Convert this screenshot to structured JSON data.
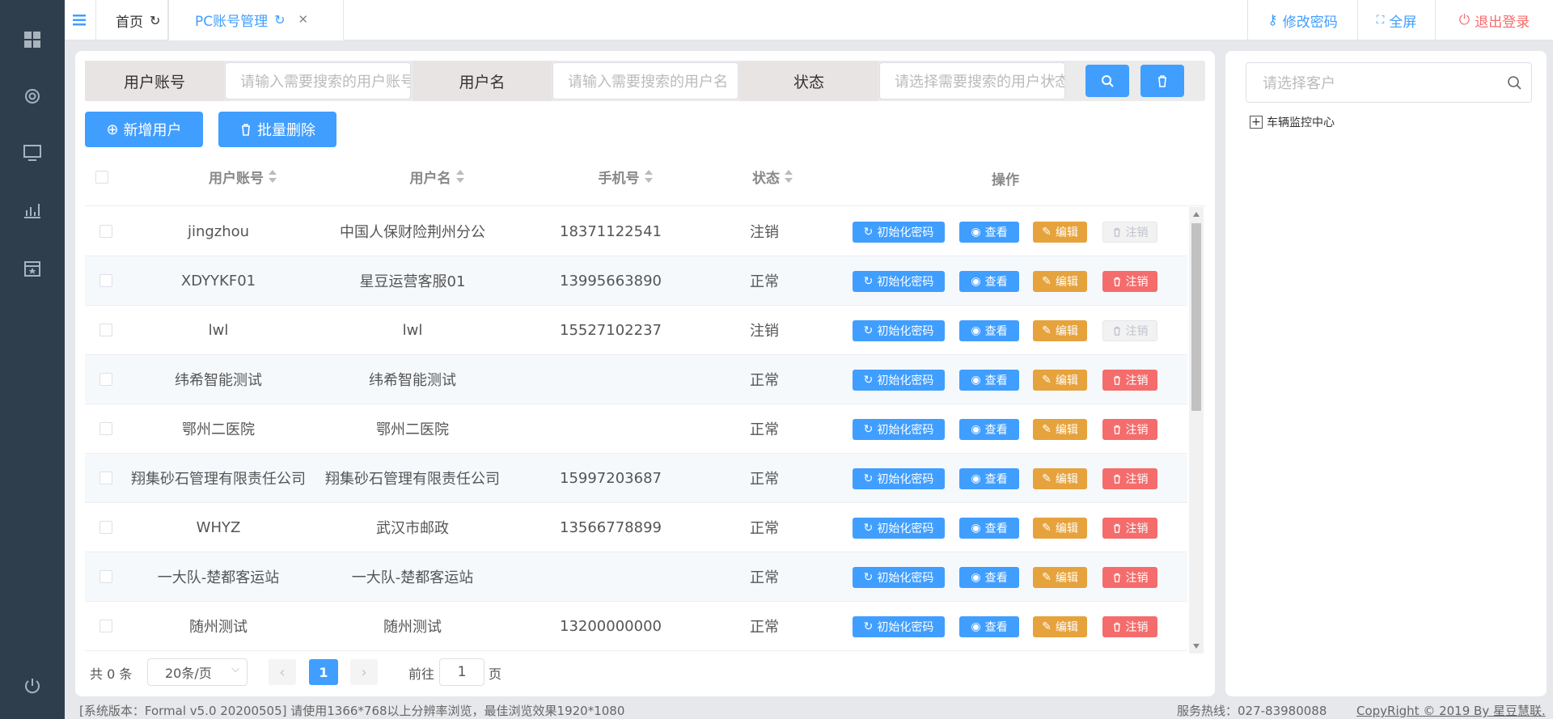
{
  "sidebar": {
    "icons": [
      "dashboard-icon",
      "gear-icon",
      "monitor-icon",
      "chart-icon",
      "calendar-icon",
      "power-icon"
    ]
  },
  "tabs": [
    {
      "label": "首页"
    },
    {
      "label": "PC账号管理"
    }
  ],
  "top_actions": {
    "change_password": "修改密码",
    "fullscreen": "全屏",
    "logout": "退出登录"
  },
  "search": {
    "account_label": "用户账号",
    "account_placeholder": "请输入需要搜索的用户账号",
    "username_label": "用户名",
    "username_placeholder": "请输入需要搜索的用户名",
    "status_label": "状态",
    "status_placeholder": "请选择需要搜索的用户状态"
  },
  "toolbar": {
    "add_label": "新增用户",
    "batch_delete_label": "批量删除"
  },
  "table": {
    "headers": {
      "account": "用户账号",
      "username": "用户名",
      "phone": "手机号",
      "status": "状态",
      "actions": "操作"
    },
    "action_labels": {
      "reset": "初始化密码",
      "view": "查看",
      "edit": "编辑",
      "cancel": "注销"
    },
    "rows": [
      {
        "account": "jingzhou",
        "username": "中国人保财险荆州分公",
        "phone": "18371122541",
        "status": "注销",
        "cancel_disabled": true
      },
      {
        "account": "XDYYKF01",
        "username": "星豆运营客服01",
        "phone": "13995663890",
        "status": "正常",
        "cancel_disabled": false
      },
      {
        "account": "lwl",
        "username": "lwl",
        "phone": "15527102237",
        "status": "注销",
        "cancel_disabled": true
      },
      {
        "account": "纬希智能测试",
        "username": "纬希智能测试",
        "phone": "",
        "status": "正常",
        "cancel_disabled": false
      },
      {
        "account": "鄂州二医院",
        "username": "鄂州二医院",
        "phone": "",
        "status": "正常",
        "cancel_disabled": false
      },
      {
        "account": "翔集砂石管理有限责任公司",
        "username": "翔集砂石管理有限责任公司",
        "phone": "15997203687",
        "status": "正常",
        "cancel_disabled": false
      },
      {
        "account": "WHYZ",
        "username": "武汉市邮政",
        "phone": "13566778899",
        "status": "正常",
        "cancel_disabled": false
      },
      {
        "account": "一大队-楚都客运站",
        "username": "一大队-楚都客运站",
        "phone": "",
        "status": "正常",
        "cancel_disabled": false
      },
      {
        "account": "随州测试",
        "username": "随州测试",
        "phone": "13200000000",
        "status": "正常",
        "cancel_disabled": false
      }
    ]
  },
  "pagination": {
    "total": "共 0 条",
    "page_size": "20条/页",
    "current_page": "1",
    "goto_prefix": "前往",
    "goto_value": "1",
    "goto_suffix": "页"
  },
  "tree": {
    "placeholder": "请选择客户",
    "root_node": "车辆监控中心"
  },
  "footer": {
    "version": "[系统版本：Formal v5.0 20200505] 请使用1366*768以上分辨率浏览，最佳浏览效果1920*1080",
    "hotline": "服务热线：027-83980088",
    "copyright": "CopyRight © 2019 By 星豆慧联."
  }
}
